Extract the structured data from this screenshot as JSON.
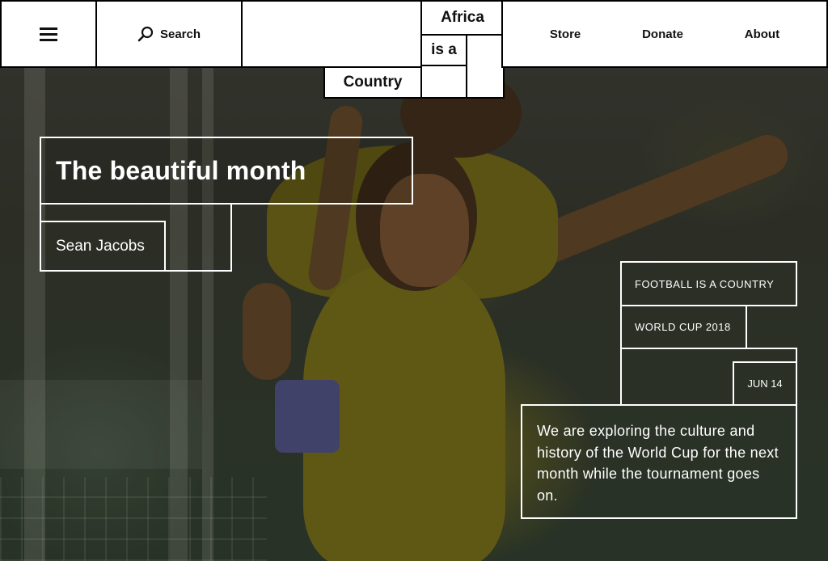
{
  "nav": {
    "search_label": "Search",
    "links": [
      "Store",
      "Donate",
      "About"
    ],
    "logo": {
      "line1": "Africa",
      "line2": "is a",
      "line3": "Country"
    }
  },
  "article": {
    "title": "The beautiful month",
    "author": "Sean Jacobs",
    "tags": [
      "FOOTBALL IS A COUNTRY",
      "WORLD CUP 2018"
    ],
    "date": "JUN 14",
    "description": "We are exploring the culture and history of the World Cup for the next month while the tournament goes on."
  },
  "icons": {
    "menu": "hamburger-icon",
    "search": "search-icon"
  }
}
